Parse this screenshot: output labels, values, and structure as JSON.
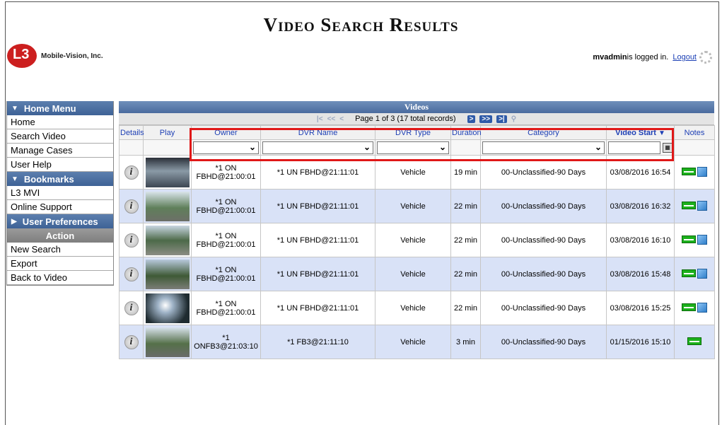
{
  "header": {
    "title": "Video Search Results",
    "company": "Mobile-Vision, Inc.",
    "logo_mark": "L3",
    "user": "mvadmin",
    "logged_in_text": " is logged in.",
    "logout_label": "Logout"
  },
  "sidebar": {
    "home_menu": {
      "title": "Home Menu",
      "items": [
        {
          "label": "Home"
        },
        {
          "label": "Search Video"
        },
        {
          "label": "Manage Cases"
        },
        {
          "label": "User Help"
        }
      ]
    },
    "bookmarks": {
      "title": "Bookmarks",
      "items": [
        {
          "label": "L3 MVI"
        },
        {
          "label": "Online Support"
        }
      ]
    },
    "user_preferences": {
      "title": "User Preferences"
    },
    "action": {
      "title": "Action",
      "items": [
        {
          "label": "New Search"
        },
        {
          "label": "Export"
        },
        {
          "label": "Back to Video"
        }
      ]
    }
  },
  "grid": {
    "title": "Videos",
    "pager_text": "Page 1 of 3 (17 total records)",
    "columns": {
      "details": "Details",
      "play": "Play",
      "owner": "Owner",
      "dvr_name": "DVR Name",
      "dvr_type": "DVR Type",
      "duration": "Duration",
      "category": "Category",
      "video_start": "Video Start",
      "notes": "Notes"
    },
    "rows": [
      {
        "owner": "*1 ON FBHD@21:00:01",
        "dvr_name": "*1 UN FBHD@21:11:01",
        "dvr_type": "Vehicle",
        "duration": "19 min",
        "category": "00-Unclassified-90 Days",
        "video_start": "03/08/2016 16:54",
        "has_doc": true
      },
      {
        "owner": "*1 ON FBHD@21:00:01",
        "dvr_name": "*1 UN FBHD@21:11:01",
        "dvr_type": "Vehicle",
        "duration": "22 min",
        "category": "00-Unclassified-90 Days",
        "video_start": "03/08/2016 16:32",
        "has_doc": true
      },
      {
        "owner": "*1 ON FBHD@21:00:01",
        "dvr_name": "*1 UN FBHD@21:11:01",
        "dvr_type": "Vehicle",
        "duration": "22 min",
        "category": "00-Unclassified-90 Days",
        "video_start": "03/08/2016 16:10",
        "has_doc": true
      },
      {
        "owner": "*1 ON FBHD@21:00:01",
        "dvr_name": "*1 UN FBHD@21:11:01",
        "dvr_type": "Vehicle",
        "duration": "22 min",
        "category": "00-Unclassified-90 Days",
        "video_start": "03/08/2016 15:48",
        "has_doc": true
      },
      {
        "owner": "*1 ON FBHD@21:00:01",
        "dvr_name": "*1 UN FBHD@21:11:01",
        "dvr_type": "Vehicle",
        "duration": "22 min",
        "category": "00-Unclassified-90 Days",
        "video_start": "03/08/2016 15:25",
        "has_doc": true
      },
      {
        "owner": "*1 ONFB3@21:03:10",
        "dvr_name": "*1 FB3@21:11:10",
        "dvr_type": "Vehicle",
        "duration": "3 min",
        "category": "00-Unclassified-90 Days",
        "video_start": "01/15/2016 15:10",
        "has_doc": false
      }
    ]
  },
  "colors": {
    "header_blue": "#4a6b9e",
    "row_alt": "#d9e2f7",
    "link_blue": "#1d3fb5",
    "highlight_red": "#e01818"
  }
}
